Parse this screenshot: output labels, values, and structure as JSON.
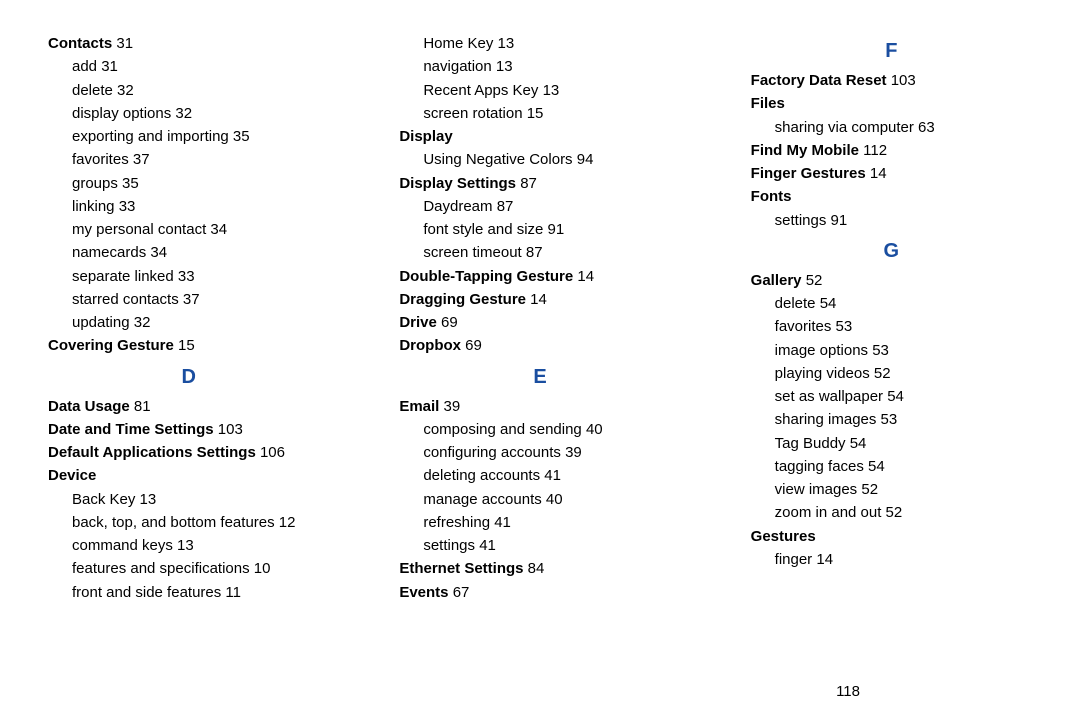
{
  "page_number": "118",
  "columns": [
    {
      "items": [
        {
          "type": "entry",
          "bold": "Contacts",
          "rest": " 31"
        },
        {
          "type": "sub",
          "text": "add 31"
        },
        {
          "type": "sub",
          "text": "delete 32"
        },
        {
          "type": "sub",
          "text": "display options 32"
        },
        {
          "type": "sub",
          "text": "exporting and importing 35"
        },
        {
          "type": "sub",
          "text": "favorites 37"
        },
        {
          "type": "sub",
          "text": "groups 35"
        },
        {
          "type": "sub",
          "text": "linking 33"
        },
        {
          "type": "sub",
          "text": "my personal contact 34"
        },
        {
          "type": "sub",
          "text": "namecards 34"
        },
        {
          "type": "sub",
          "text": "separate linked 33"
        },
        {
          "type": "sub",
          "text": "starred contacts 37"
        },
        {
          "type": "sub",
          "text": "updating 32"
        },
        {
          "type": "entry",
          "bold": "Covering Gesture",
          "rest": " 15"
        },
        {
          "type": "letter",
          "text": "D"
        },
        {
          "type": "entry",
          "bold": "Data Usage",
          "rest": " 81"
        },
        {
          "type": "entry",
          "bold": "Date and Time Settings",
          "rest": " 103"
        },
        {
          "type": "entry",
          "bold": "Default Applications Settings",
          "rest": " 106"
        },
        {
          "type": "entry",
          "bold": "Device",
          "rest": ""
        },
        {
          "type": "sub",
          "text": "Back Key 13"
        },
        {
          "type": "sub",
          "text": "back, top, and bottom features 12"
        },
        {
          "type": "sub",
          "text": "command keys 13"
        },
        {
          "type": "sub",
          "text": "features and specifications 10"
        },
        {
          "type": "sub",
          "text": "front and side features 11"
        }
      ]
    },
    {
      "items": [
        {
          "type": "sub",
          "text": "Home Key 13"
        },
        {
          "type": "sub",
          "text": "navigation 13"
        },
        {
          "type": "sub",
          "text": "Recent Apps Key 13"
        },
        {
          "type": "sub",
          "text": "screen rotation 15"
        },
        {
          "type": "entry",
          "bold": "Display",
          "rest": ""
        },
        {
          "type": "sub",
          "text": "Using Negative Colors 94"
        },
        {
          "type": "entry",
          "bold": "Display Settings",
          "rest": " 87"
        },
        {
          "type": "sub",
          "text": "Daydream 87"
        },
        {
          "type": "sub",
          "text": "font style and size 91"
        },
        {
          "type": "sub",
          "text": "screen timeout 87"
        },
        {
          "type": "entry",
          "bold": "Double-Tapping Gesture",
          "rest": " 14"
        },
        {
          "type": "entry",
          "bold": "Dragging Gesture",
          "rest": " 14"
        },
        {
          "type": "entry",
          "bold": "Drive",
          "rest": " 69"
        },
        {
          "type": "entry",
          "bold": "Dropbox",
          "rest": " 69"
        },
        {
          "type": "letter",
          "text": "E"
        },
        {
          "type": "entry",
          "bold": "Email",
          "rest": " 39"
        },
        {
          "type": "sub",
          "text": "composing and sending 40"
        },
        {
          "type": "sub",
          "text": "configuring accounts 39"
        },
        {
          "type": "sub",
          "text": "deleting accounts 41"
        },
        {
          "type": "sub",
          "text": "manage accounts 40"
        },
        {
          "type": "sub",
          "text": "refreshing 41"
        },
        {
          "type": "sub",
          "text": "settings 41"
        },
        {
          "type": "entry",
          "bold": "Ethernet Settings",
          "rest": " 84"
        },
        {
          "type": "entry",
          "bold": "Events",
          "rest": " 67"
        }
      ]
    },
    {
      "items": [
        {
          "type": "letter",
          "text": "F"
        },
        {
          "type": "entry",
          "bold": "Factory Data Reset",
          "rest": " 103"
        },
        {
          "type": "entry",
          "bold": "Files",
          "rest": ""
        },
        {
          "type": "sub",
          "text": "sharing via computer 63"
        },
        {
          "type": "entry",
          "bold": "Find My Mobile",
          "rest": " 112"
        },
        {
          "type": "entry",
          "bold": "Finger Gestures",
          "rest": " 14"
        },
        {
          "type": "entry",
          "bold": "Fonts",
          "rest": ""
        },
        {
          "type": "sub",
          "text": "settings 91"
        },
        {
          "type": "letter",
          "text": "G"
        },
        {
          "type": "entry",
          "bold": "Gallery",
          "rest": " 52"
        },
        {
          "type": "sub",
          "text": "delete 54"
        },
        {
          "type": "sub",
          "text": "favorites 53"
        },
        {
          "type": "sub",
          "text": "image options 53"
        },
        {
          "type": "sub",
          "text": "playing videos 52"
        },
        {
          "type": "sub",
          "text": "set as wallpaper 54"
        },
        {
          "type": "sub",
          "text": "sharing images 53"
        },
        {
          "type": "sub",
          "text": "Tag Buddy 54"
        },
        {
          "type": "sub",
          "text": "tagging faces 54"
        },
        {
          "type": "sub",
          "text": "view images 52"
        },
        {
          "type": "sub",
          "text": "zoom in and out 52"
        },
        {
          "type": "entry",
          "bold": "Gestures",
          "rest": ""
        },
        {
          "type": "sub",
          "text": "finger 14"
        }
      ]
    }
  ]
}
